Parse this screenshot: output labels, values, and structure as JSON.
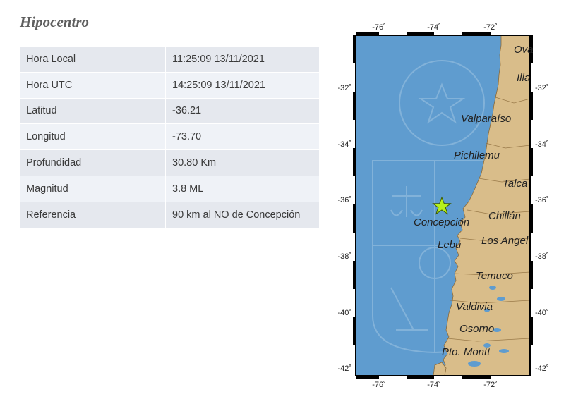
{
  "section_title": "Hipocentro",
  "rows": [
    {
      "label": "Hora Local",
      "value": "11:25:09 13/11/2021"
    },
    {
      "label": "Hora UTC",
      "value": "14:25:09 13/11/2021"
    },
    {
      "label": "Latitud",
      "value": "-36.21"
    },
    {
      "label": "Longitud",
      "value": "-73.70"
    },
    {
      "label": "Profundidad",
      "value": "30.80 Km"
    },
    {
      "label": "Magnitud",
      "value": "3.8 ML"
    },
    {
      "label": "Referencia",
      "value": "90 km al NO de Concepción"
    }
  ],
  "map": {
    "lon_ticks": [
      "-76˚",
      "-74˚",
      "-72˚"
    ],
    "lat_ticks": [
      "-32˚",
      "-34˚",
      "-36˚",
      "-38˚",
      "-40˚",
      "-42˚"
    ],
    "places": [
      "Ova",
      "Illa",
      "Valparaíso",
      "Pichilemu",
      "Talca",
      "Concepción",
      "Chillán",
      "Lebu",
      "Los Angel",
      "Temuco",
      "Valdivia",
      "Osorno",
      "Pto. Montt"
    ],
    "epicenter_icon": "star-icon",
    "colors": {
      "ocean": "#5f9ccf",
      "land": "#d9bd8a",
      "epicenter": "#b6f21c"
    }
  }
}
